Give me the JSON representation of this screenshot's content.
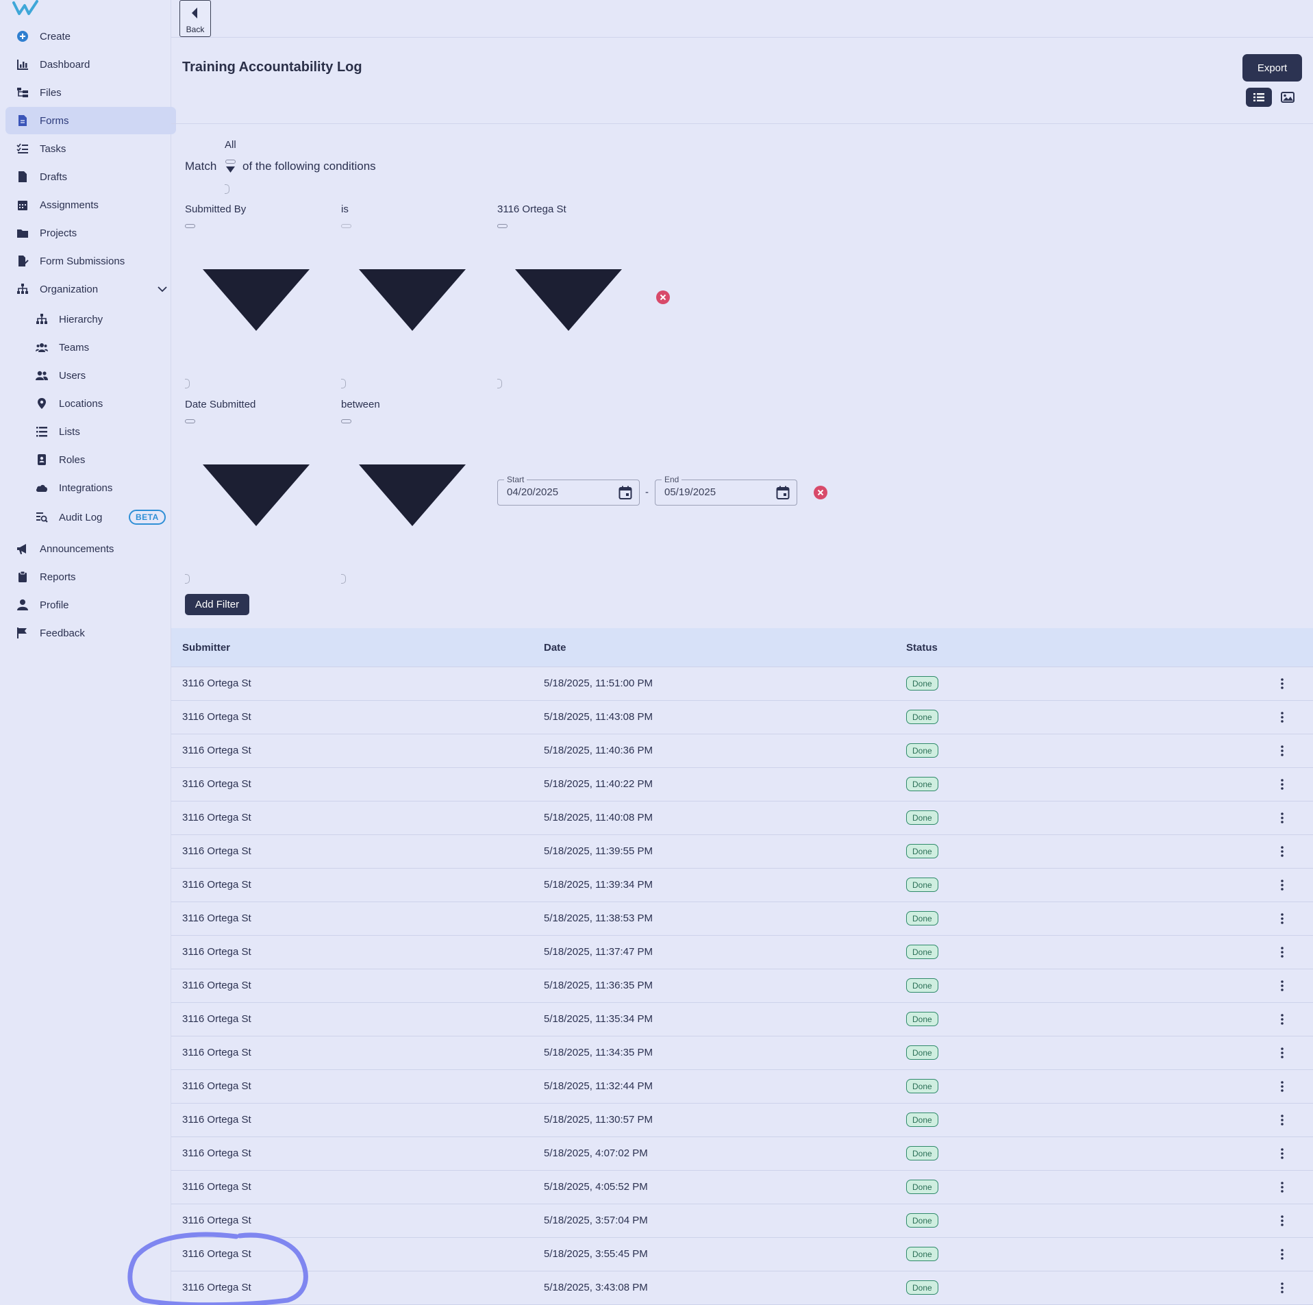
{
  "sidebar": {
    "items": [
      {
        "label": "Create",
        "icon": "plus-circle-icon"
      },
      {
        "label": "Dashboard",
        "icon": "chart-icon"
      },
      {
        "label": "Files",
        "icon": "folder-tree-icon"
      },
      {
        "label": "Forms",
        "icon": "document-icon",
        "active": true
      },
      {
        "label": "Tasks",
        "icon": "checklist-icon"
      },
      {
        "label": "Drafts",
        "icon": "file-icon"
      },
      {
        "label": "Assignments",
        "icon": "calendar-icon"
      },
      {
        "label": "Projects",
        "icon": "folder-icon"
      },
      {
        "label": "Form Submissions",
        "icon": "file-signature-icon"
      },
      {
        "label": "Organization",
        "icon": "sitemap-icon"
      }
    ],
    "sub_items": [
      {
        "label": "Hierarchy",
        "icon": "sitemap-icon"
      },
      {
        "label": "Teams",
        "icon": "users-group-icon"
      },
      {
        "label": "Users",
        "icon": "users-icon"
      },
      {
        "label": "Locations",
        "icon": "location-pin-icon"
      },
      {
        "label": "Lists",
        "icon": "list-icon"
      },
      {
        "label": "Roles",
        "icon": "id-badge-icon"
      },
      {
        "label": "Integrations",
        "icon": "cloud-icon"
      },
      {
        "label": "Audit Log",
        "icon": "search-list-icon",
        "badge": "BETA"
      }
    ],
    "bottom_items": [
      {
        "label": "Announcements",
        "icon": "megaphone-icon"
      },
      {
        "label": "Reports",
        "icon": "clipboard-icon"
      },
      {
        "label": "Profile",
        "icon": "user-icon"
      },
      {
        "label": "Feedback",
        "icon": "flag-icon"
      }
    ]
  },
  "header": {
    "back_label": "Back",
    "title": "Training Accountability Log",
    "export_label": "Export"
  },
  "filter": {
    "match_label": "Match",
    "match_value": "All",
    "conditions_label": "of the following conditions",
    "rules": [
      {
        "field": "Submitted By",
        "operator": "is",
        "value": "3116 Ortega St"
      },
      {
        "field": "Date Submitted",
        "operator": "between",
        "start_label": "Start",
        "start": "04/20/2025",
        "end_label": "End",
        "end": "05/19/2025"
      }
    ],
    "date_separator": "-",
    "add_filter_label": "Add Filter"
  },
  "table": {
    "headers": [
      "Submitter",
      "Date",
      "Status"
    ],
    "rows": [
      {
        "submitter": "3116 Ortega St",
        "date": "5/18/2025, 11:51:00 PM",
        "status": "Done"
      },
      {
        "submitter": "3116 Ortega St",
        "date": "5/18/2025, 11:43:08 PM",
        "status": "Done"
      },
      {
        "submitter": "3116 Ortega St",
        "date": "5/18/2025, 11:40:36 PM",
        "status": "Done"
      },
      {
        "submitter": "3116 Ortega St",
        "date": "5/18/2025, 11:40:22 PM",
        "status": "Done"
      },
      {
        "submitter": "3116 Ortega St",
        "date": "5/18/2025, 11:40:08 PM",
        "status": "Done"
      },
      {
        "submitter": "3116 Ortega St",
        "date": "5/18/2025, 11:39:55 PM",
        "status": "Done"
      },
      {
        "submitter": "3116 Ortega St",
        "date": "5/18/2025, 11:39:34 PM",
        "status": "Done"
      },
      {
        "submitter": "3116 Ortega St",
        "date": "5/18/2025, 11:38:53 PM",
        "status": "Done"
      },
      {
        "submitter": "3116 Ortega St",
        "date": "5/18/2025, 11:37:47 PM",
        "status": "Done"
      },
      {
        "submitter": "3116 Ortega St",
        "date": "5/18/2025, 11:36:35 PM",
        "status": "Done"
      },
      {
        "submitter": "3116 Ortega St",
        "date": "5/18/2025, 11:35:34 PM",
        "status": "Done"
      },
      {
        "submitter": "3116 Ortega St",
        "date": "5/18/2025, 11:34:35 PM",
        "status": "Done"
      },
      {
        "submitter": "3116 Ortega St",
        "date": "5/18/2025, 11:32:44 PM",
        "status": "Done"
      },
      {
        "submitter": "3116 Ortega St",
        "date": "5/18/2025, 11:30:57 PM",
        "status": "Done"
      },
      {
        "submitter": "3116 Ortega St",
        "date": "5/18/2025, 4:07:02 PM",
        "status": "Done"
      },
      {
        "submitter": "3116 Ortega St",
        "date": "5/18/2025, 4:05:52 PM",
        "status": "Done"
      },
      {
        "submitter": "3116 Ortega St",
        "date": "5/18/2025, 3:57:04 PM",
        "status": "Done"
      },
      {
        "submitter": "3116 Ortega St",
        "date": "5/18/2025, 3:55:45 PM",
        "status": "Done"
      },
      {
        "submitter": "3116 Ortega St",
        "date": "5/18/2025, 3:43:08 PM",
        "status": "Done"
      }
    ]
  },
  "colors": {
    "background": "#e4e7f8",
    "primary_button": "#2c3352",
    "active_nav": "#cfd7f4",
    "header_row": "#d7e1f8",
    "status_done": "#2f8a6a",
    "remove": "#d84a6a",
    "annotation": "#7f86f0"
  }
}
